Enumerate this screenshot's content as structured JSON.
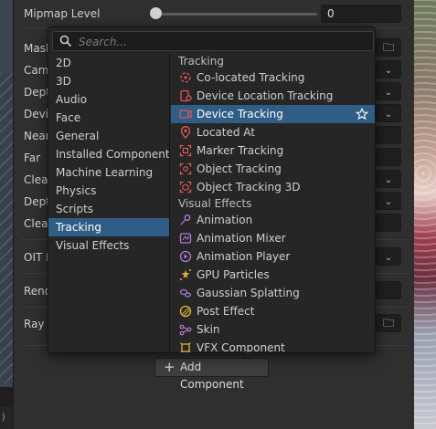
{
  "inspector": {
    "mipmap_label": "Mipmap Level",
    "mipmap_value": "0",
    "labels": [
      "Mask",
      "Came",
      "Dept",
      "Devic",
      "Near",
      "Far",
      "Clear",
      "Dept",
      "Clear",
      "OIT M",
      "Rend",
      "Ray T"
    ]
  },
  "popup": {
    "search_placeholder": "Search...",
    "categories": [
      "2D",
      "3D",
      "Audio",
      "Face",
      "General",
      "Installed Components",
      "Machine Learning",
      "Physics",
      "Scripts",
      "Tracking",
      "Visual Effects"
    ],
    "active_category": "Tracking",
    "groups": {
      "tracking": "Tracking",
      "visual_effects": "Visual Effects"
    },
    "tracking_items": [
      {
        "label": "Co-located Tracking",
        "icon": "colocated-tracking-icon"
      },
      {
        "label": "Device Location Tracking",
        "icon": "device-location-icon"
      },
      {
        "label": "Device Tracking",
        "icon": "device-tracking-icon"
      },
      {
        "label": "Located At",
        "icon": "location-pin-icon"
      },
      {
        "label": "Marker Tracking",
        "icon": "marker-tracking-icon"
      },
      {
        "label": "Object Tracking",
        "icon": "object-tracking-icon"
      },
      {
        "label": "Object Tracking 3D",
        "icon": "object-tracking-3d-icon"
      }
    ],
    "visual_effects_items": [
      {
        "label": "Animation",
        "icon": "animation-icon"
      },
      {
        "label": "Animation Mixer",
        "icon": "animation-mixer-icon"
      },
      {
        "label": "Animation Player",
        "icon": "animation-player-icon"
      },
      {
        "label": "GPU Particles",
        "icon": "gpu-particles-icon"
      },
      {
        "label": "Gaussian Splatting",
        "icon": "gaussian-splatting-icon"
      },
      {
        "label": "Post Effect",
        "icon": "post-effect-icon"
      },
      {
        "label": "Skin",
        "icon": "skin-icon"
      },
      {
        "label": "VFX Component",
        "icon": "vfx-component-icon"
      }
    ],
    "selected_item": "Device Tracking"
  },
  "add_component_label": "Add Component",
  "colors": {
    "accent": "#2f5d86",
    "tracking_icon": "#e05a5a",
    "vfx_icon": "#b07ad6",
    "particles_icon": "#e0b43c"
  }
}
